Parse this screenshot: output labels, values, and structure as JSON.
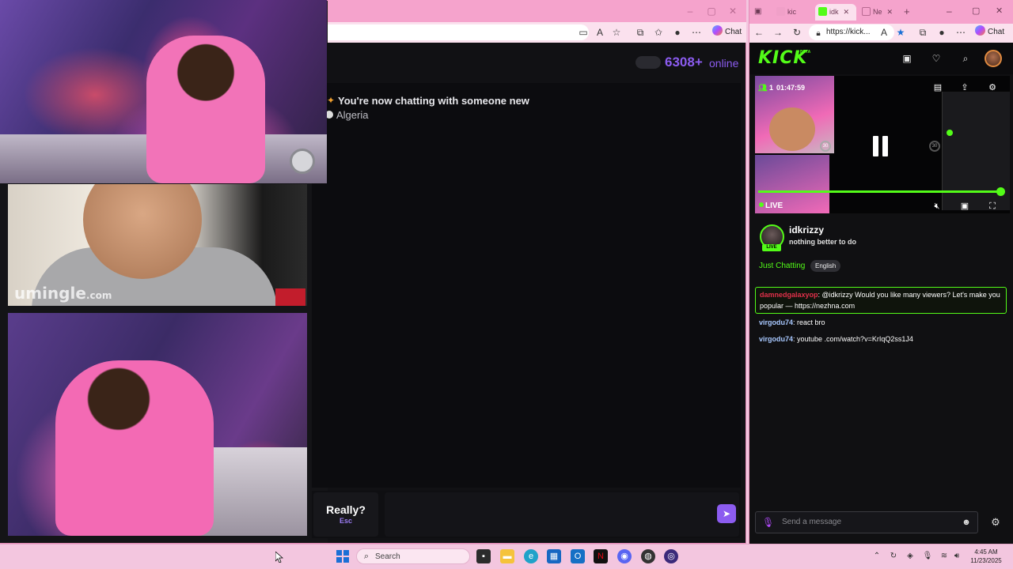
{
  "left_browser": {
    "chat_button": "Chat",
    "online_count": "6308+",
    "online_word": "online",
    "system_message": "You're now chatting with someone new",
    "country": "Algeria",
    "watermark_brand": "umingle",
    "watermark_tld": ".com",
    "skip_button": "Really?",
    "skip_shortcut": "Esc"
  },
  "right_browser": {
    "tabs": [
      {
        "label": "kic"
      },
      {
        "label": "idk"
      },
      {
        "label": "Ne"
      }
    ],
    "address": "https://kick...",
    "chat_button": "Chat",
    "brand": "KICK",
    "brand_tag": "BETA",
    "viewers": "1",
    "uptime": "01:47:59",
    "live_label": "LIVE",
    "streamer": {
      "name": "idkrizzy",
      "title": "nothing better to do",
      "live_tag": "LIVE",
      "category": "Just Chatting",
      "language": "English"
    },
    "chat": [
      {
        "user": "damnedgalaxyop",
        "text": ": @idkrizzy Would you like many viewers? Let's make you popular — https://nezhna.com",
        "highlight": true
      },
      {
        "user": "virgodu74",
        "text": ": react bro",
        "highlight": false
      },
      {
        "user": "virgodu74",
        "text": ": youtube .com/watch?v=KrIqQ2ss1J4",
        "highlight": false
      }
    ],
    "send_placeholder": "Send a message"
  },
  "taskbar": {
    "search_label": "Search",
    "time": "4:45 AM",
    "date": "11/23/2025"
  },
  "colors": {
    "kick_green": "#53fc18",
    "umingle_purple": "#8c5cf0",
    "window_pink": "#f5a3cc"
  }
}
